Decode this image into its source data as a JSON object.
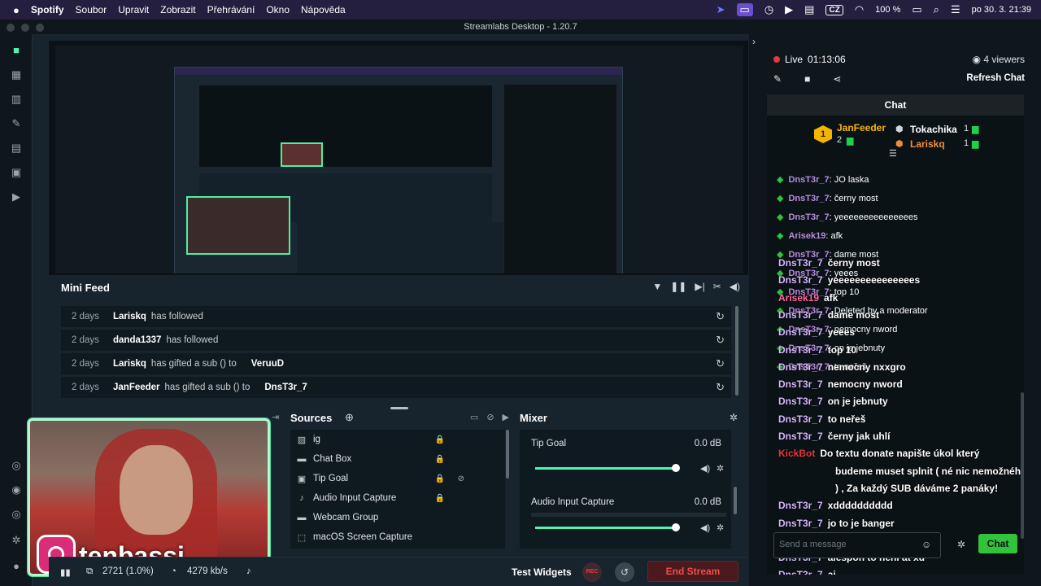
{
  "macbar": {
    "apple": "",
    "app": "Spotify",
    "menus": [
      "Soubor",
      "Upravit",
      "Zobrazit",
      "Přehrávání",
      "Okno",
      "Nápověda"
    ],
    "lang": "CZ",
    "battery": "100 %",
    "datetime": "po 30. 3.  21:39"
  },
  "window": {
    "title": "Streamlabs Desktop - 1.20.7"
  },
  "mini_feed": {
    "title": "Mini Feed",
    "rows": [
      {
        "date": "2 days",
        "user": "Lariskq",
        "action": "has followed",
        "target": ""
      },
      {
        "date": "2 days",
        "user": "danda1337",
        "action": "has followed",
        "target": ""
      },
      {
        "date": "2 days",
        "user": "Lariskq",
        "action": "has gifted a sub () to",
        "target": "VeruuD"
      },
      {
        "date": "2 days",
        "user": "JanFeeder",
        "action": "has gifted a sub () to",
        "target": "DnsT3r_7"
      }
    ]
  },
  "sources": {
    "title": "Sources",
    "items": [
      "ig",
      "Chat Box",
      "Tip Goal",
      "Audio Input Capture",
      "Webcam Group",
      "macOS Screen Capture"
    ]
  },
  "mixer": {
    "title": "Mixer",
    "items": [
      {
        "name": "Tip Goal",
        "db": "0.0 dB",
        "level": 0.97
      },
      {
        "name": "Audio Input Capture",
        "db": "0.0 dB",
        "level": 0.97
      }
    ]
  },
  "webcam": {
    "handle": "tenbassj"
  },
  "footer": {
    "frames": "2721 (1.0%)",
    "bitrate": "4279 kb/s",
    "test_widgets": "Test Widgets",
    "rec": "REC",
    "end_stream": "End Stream"
  },
  "right": {
    "live": "Live",
    "time": "01:13:06",
    "viewers": "4 viewers",
    "refresh": "Refresh Chat",
    "chat": {
      "title": "Chat",
      "hype": [
        {
          "rank": "1",
          "name": "JanFeeder",
          "count": "2"
        },
        {
          "name": "Tokachika",
          "count": "1"
        },
        {
          "name": "Lariskq",
          "count": "1"
        }
      ],
      "lines": [
        {
          "user": "DnsT3r_7",
          "text": "JO laska"
        },
        {
          "user": "DnsT3r_7",
          "text": "černy most"
        },
        {
          "user": "DnsT3r_7",
          "text": "yeeeeeeeeeeeeeees"
        },
        {
          "user": "Arisek19",
          "text": "afk"
        },
        {
          "user": "DnsT3r_7",
          "text": "dame most"
        },
        {
          "user": "DnsT3r_7",
          "text": "yeees"
        },
        {
          "user": "DnsT3r_7",
          "text": "top 10"
        },
        {
          "user": "DnsT3r_7",
          "text": "Deleted by a moderator"
        },
        {
          "user": "DnsT3r_7",
          "text": "nemocny nword"
        },
        {
          "user": "DnsT3r_7",
          "text": "on je jebnuty"
        },
        {
          "user": "DnsT3r_7",
          "text": "to neřeš"
        }
      ],
      "overlay": [
        {
          "user": "DnsT3r_7",
          "text": "černy most"
        },
        {
          "user": "DnsT3r_7",
          "text": "yeeeeeeeeeeeeeees"
        },
        {
          "user": "Arisek19",
          "text": "afk"
        },
        {
          "user": "DnsT3r_7",
          "text": "dame most"
        },
        {
          "user": "DnsT3r_7",
          "text": "yeees"
        },
        {
          "user": "DnsT3r_7",
          "text": "top 10"
        },
        {
          "user": "DnsT3r_7",
          "text": "nemocny nxxgro"
        },
        {
          "user": "DnsT3r_7",
          "text": "nemocny nword"
        },
        {
          "user": "DnsT3r_7",
          "text": "on je jebnuty"
        },
        {
          "user": "DnsT3r_7",
          "text": "to neřeš"
        },
        {
          "user": "DnsT3r_7",
          "text": "černy jak uhlí"
        },
        {
          "user": "KickBot",
          "text": "Do textu donate napište úkol který"
        },
        {
          "user": "",
          "text": "budeme muset splnit ( né nic nemožného"
        },
        {
          "user": "",
          "text": ") , Za každý SUB dáváme 2 panáky!"
        },
        {
          "user": "DnsT3r_7",
          "text": "xdddddddddd"
        },
        {
          "user": "DnsT3r_7",
          "text": "jo to je banger"
        },
        {
          "user": "DnsT3r_7",
          "text": "to zahraju"
        },
        {
          "user": "DnsT3r_7",
          "text": "alespon to neni at xd"
        },
        {
          "user": "DnsT3r_7",
          "text": "ai"
        }
      ],
      "input_placeholder": "Send a message",
      "send": "Chat"
    }
  }
}
